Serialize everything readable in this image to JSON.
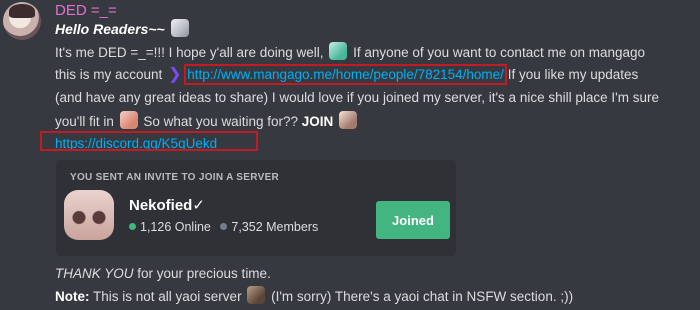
{
  "message": {
    "username": "DED =_=",
    "greeting": "Hello Readers~~",
    "line1_a": "It's me DED =_=!!! I hope y'all are doing well,",
    "line1_b": " If anyone of you want to contact me on mangago",
    "line2_a": "this is my account",
    "mangago_link": "http://www.mangago.me/home/people/782154/home/",
    "line2_b": " If you like my updates",
    "line3": "(and have any great ideas to share) I would love if you  joined my server, it's a nice shill place I'm sure",
    "line4_a": "you'll fit in",
    "line4_b": " So what you waiting for?? ",
    "join_word": "JOIN",
    "discord_link": "https://discord.gg/K5gUekd",
    "thanks_italic": "THANK YOU",
    "thanks_rest": " for your precious time.",
    "note_label": "Note:",
    "note_a": "  This is not all yaoi server",
    "note_b": " (I'm sorry) There's a yaoi chat in NSFW section. ;))"
  },
  "invite": {
    "header": "YOU SENT AN INVITE TO JOIN A SERVER",
    "server_name": "Nekofied✓",
    "online_count": "1,126 Online",
    "member_count": "7,352 Members",
    "button_label": "Joined"
  },
  "icons": [
    "avatar",
    "cat-emoji",
    "mint-emoji",
    "arrow-icon",
    "pink-emoji",
    "girl-emoji",
    "brown-emoji"
  ],
  "colors": {
    "background": "#36393f",
    "username": "#e36fd2",
    "link": "#00aff4",
    "highlight_box": "#c01c24",
    "joined_button": "#43b581"
  }
}
